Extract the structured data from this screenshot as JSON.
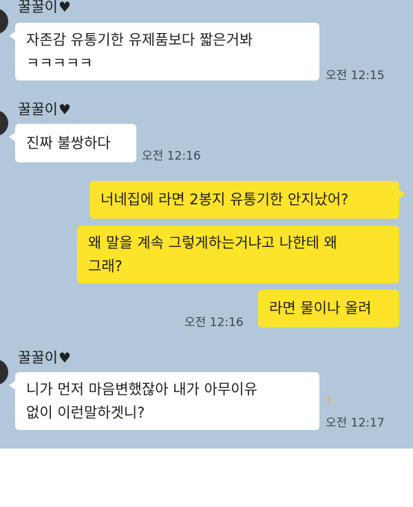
{
  "messages": [
    {
      "sender": "꿀꿀이",
      "heart": "♥",
      "lines": [
        "자존감 유통기한 유제품보다 짧은거봐",
        "ㅋㅋㅋㅋㅋ"
      ],
      "time": "오전 12:15"
    },
    {
      "sender": "꿀꿀이",
      "heart": "♥",
      "lines": [
        "진짜 불쌍하다"
      ],
      "time": "오전 12:16"
    },
    {
      "lines": [
        "너네집에 라면 2봉지 유통기한 안지났어?"
      ]
    },
    {
      "lines": [
        "왜 말을 계속 그렇게하는거냐고 나한테 왜",
        "그래?"
      ]
    },
    {
      "lines": [
        "라면 물이나 올려"
      ],
      "time": "오전 12:16"
    },
    {
      "sender": "꿀꿀이",
      "heart": "♥",
      "lines": [
        "니가 먼저 마음변했잖아 내가 아무이유",
        "없이 이런말하겟니?"
      ],
      "unread": "1",
      "time": "오전 12:17"
    }
  ]
}
